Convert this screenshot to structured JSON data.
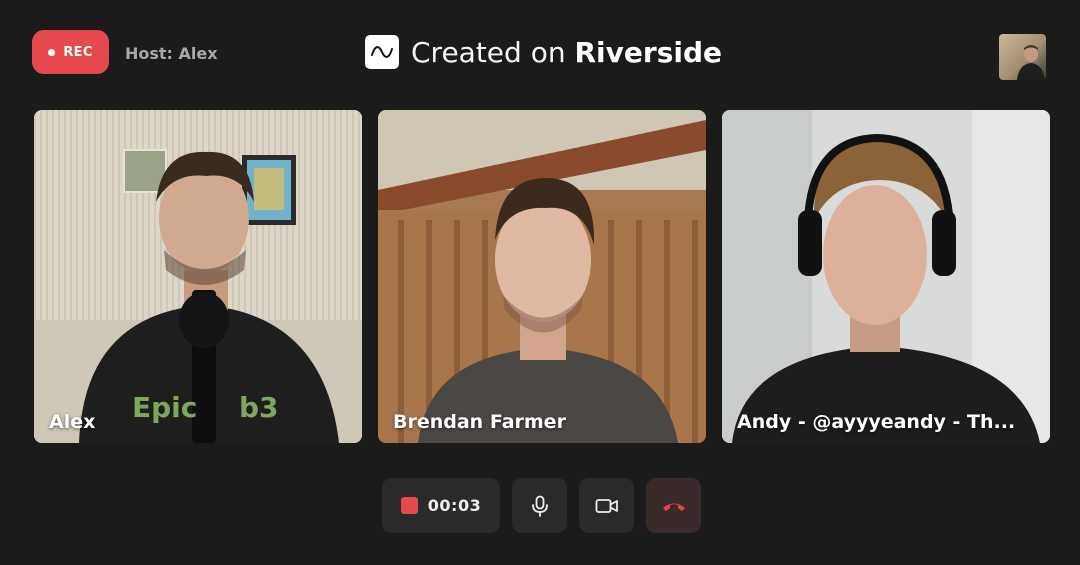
{
  "header": {
    "rec_label": "REC",
    "host_label": "Host: Alex",
    "brand_prefix": "Created on ",
    "brand_name": "Riverside"
  },
  "participants": [
    {
      "name": "Alex"
    },
    {
      "name": "Brendan Farmer"
    },
    {
      "name": "Andy - @ayyyeandy - Th..."
    }
  ],
  "controls": {
    "timer": "00:03"
  },
  "colors": {
    "background": "#1b1b1b",
    "record_red": "#e5484d",
    "control_bg": "#2a2a2a"
  },
  "icons": [
    "record-dot-icon",
    "riverside-logo-icon",
    "stop-icon",
    "microphone-icon",
    "camera-icon",
    "end-call-icon"
  ]
}
